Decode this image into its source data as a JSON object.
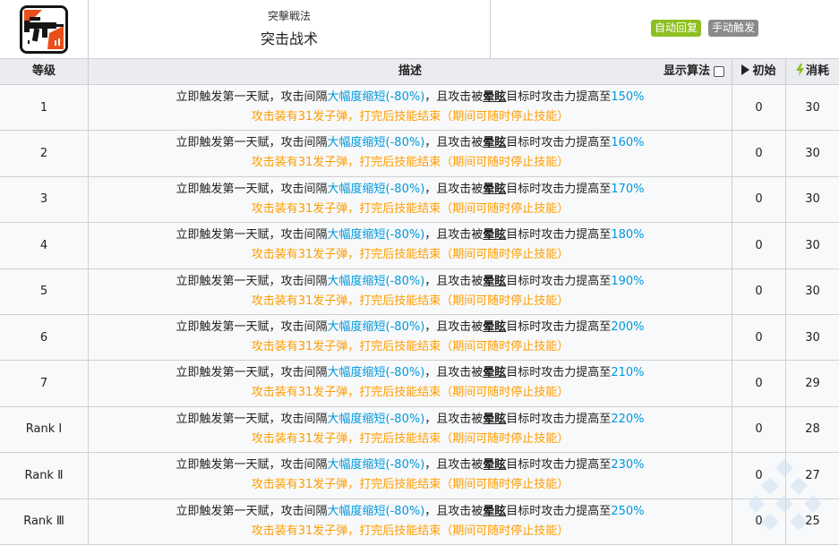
{
  "skill": {
    "subtitle": "突擊戦法",
    "name": "突击战术",
    "badges": [
      {
        "label": "自动回复",
        "color": "#8ebf21"
      },
      {
        "label": "手动触发",
        "color": "#8a8a8a"
      }
    ],
    "icon": "assault-rifle-icon"
  },
  "table": {
    "headers": {
      "level": "等级",
      "description": "描述",
      "toggle": "显示算法",
      "initial": "初始",
      "cost": "消耗"
    },
    "desc_parts": {
      "a": "立即触发第一天赋，攻击间隔",
      "b": "大幅度缩短(-80%)",
      "c": "，且攻击被",
      "d": "晕眩",
      "e": "目标时攻击力提高至",
      "line2": "攻击装有31发子弹，打完后技能结束（期间可随时停止技能）"
    },
    "rows": [
      {
        "level": "1",
        "pct": "150%",
        "initial": "0",
        "cost": "30"
      },
      {
        "level": "2",
        "pct": "160%",
        "initial": "0",
        "cost": "30"
      },
      {
        "level": "3",
        "pct": "170%",
        "initial": "0",
        "cost": "30"
      },
      {
        "level": "4",
        "pct": "180%",
        "initial": "0",
        "cost": "30"
      },
      {
        "level": "5",
        "pct": "190%",
        "initial": "0",
        "cost": "30"
      },
      {
        "level": "6",
        "pct": "200%",
        "initial": "0",
        "cost": "30"
      },
      {
        "level": "7",
        "pct": "210%",
        "initial": "0",
        "cost": "29"
      },
      {
        "level": "Rank Ⅰ",
        "pct": "220%",
        "initial": "0",
        "cost": "28"
      },
      {
        "level": "Rank Ⅱ",
        "pct": "230%",
        "initial": "0",
        "cost": "27"
      },
      {
        "level": "Rank Ⅲ",
        "pct": "250%",
        "initial": "0",
        "cost": "25"
      }
    ]
  },
  "colors": {
    "highlight_blue": "#0098dc",
    "highlight_orange": "#ff9d00",
    "header_bg": "#eaecf0"
  }
}
